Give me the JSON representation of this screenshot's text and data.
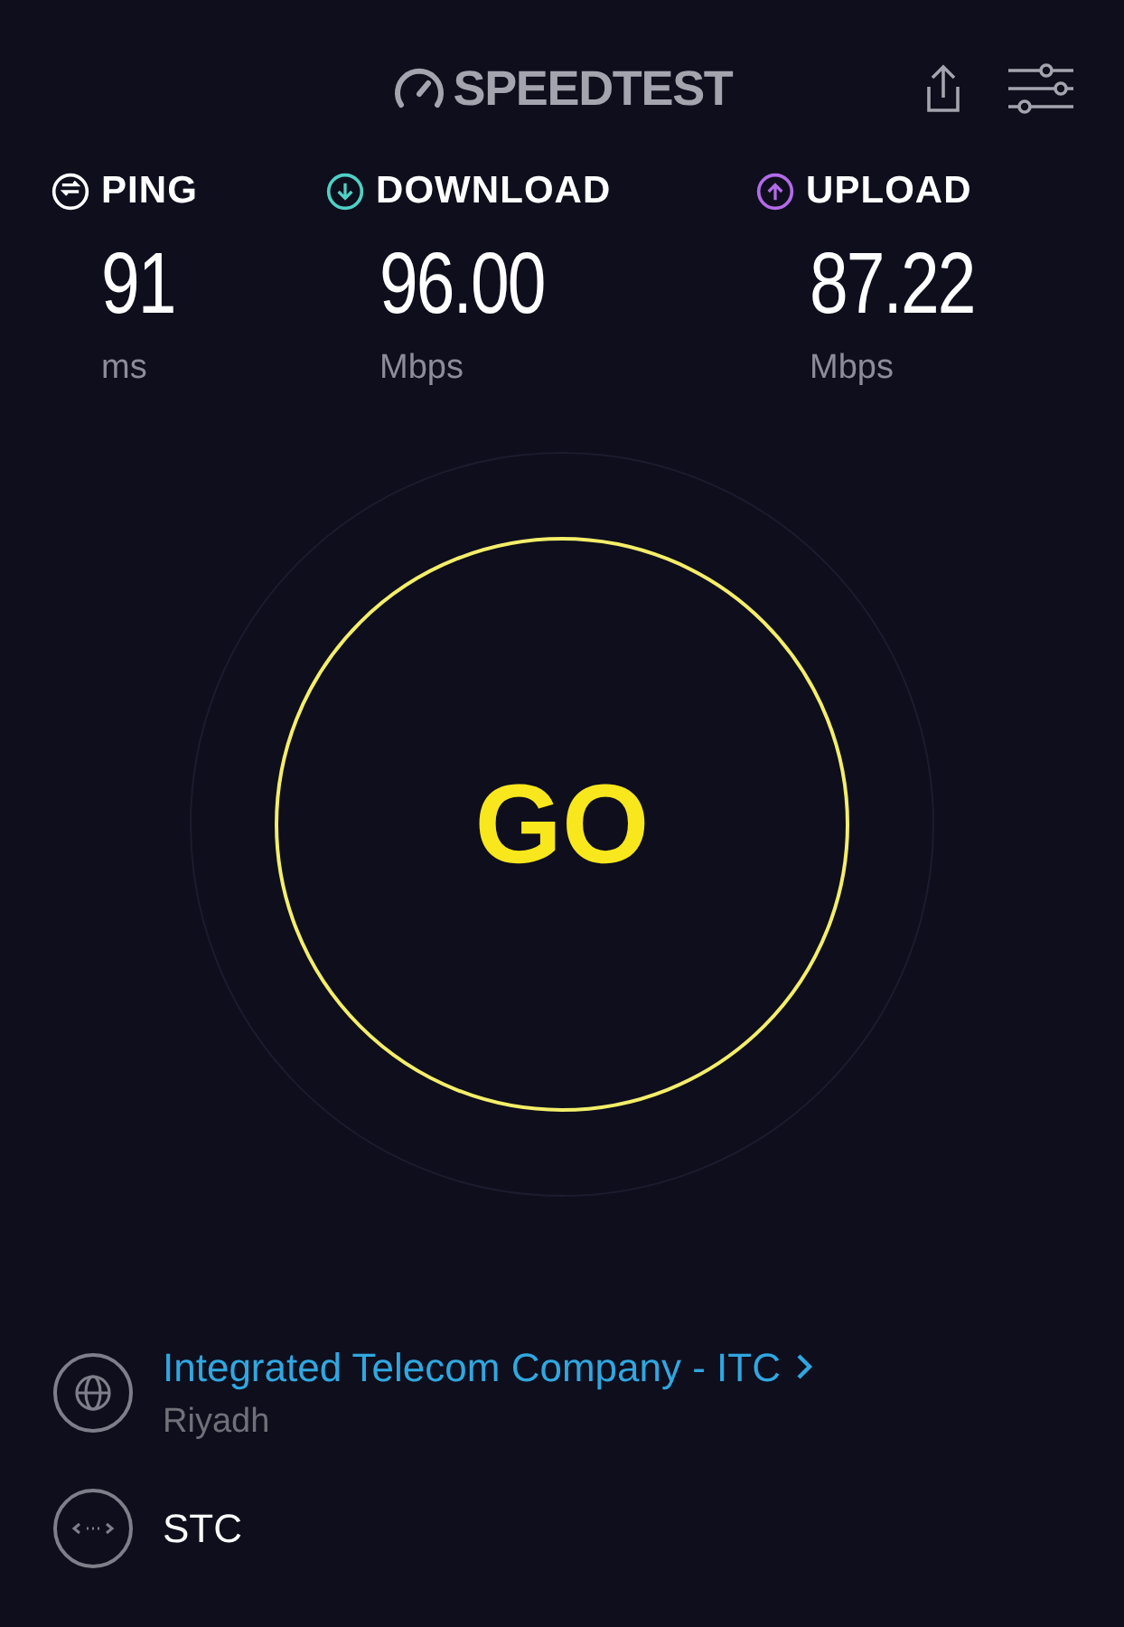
{
  "header": {
    "logo": "SPEEDTEST"
  },
  "metrics": [
    {
      "kind": "ping",
      "label": "PING",
      "value": "91",
      "unit": "ms",
      "color": "#ffffff"
    },
    {
      "kind": "download",
      "label": "DOWNLOAD",
      "value": "96.00",
      "unit": "Mbps",
      "color": "#4fd1c5"
    },
    {
      "kind": "upload",
      "label": "UPLOAD",
      "value": "87.22",
      "unit": "Mbps",
      "color": "#b36be8"
    }
  ],
  "go_button": {
    "label": "GO"
  },
  "server": {
    "name": "Integrated Telecom Company - ITC",
    "location": "Riyadh"
  },
  "provider": {
    "name": "STC"
  }
}
